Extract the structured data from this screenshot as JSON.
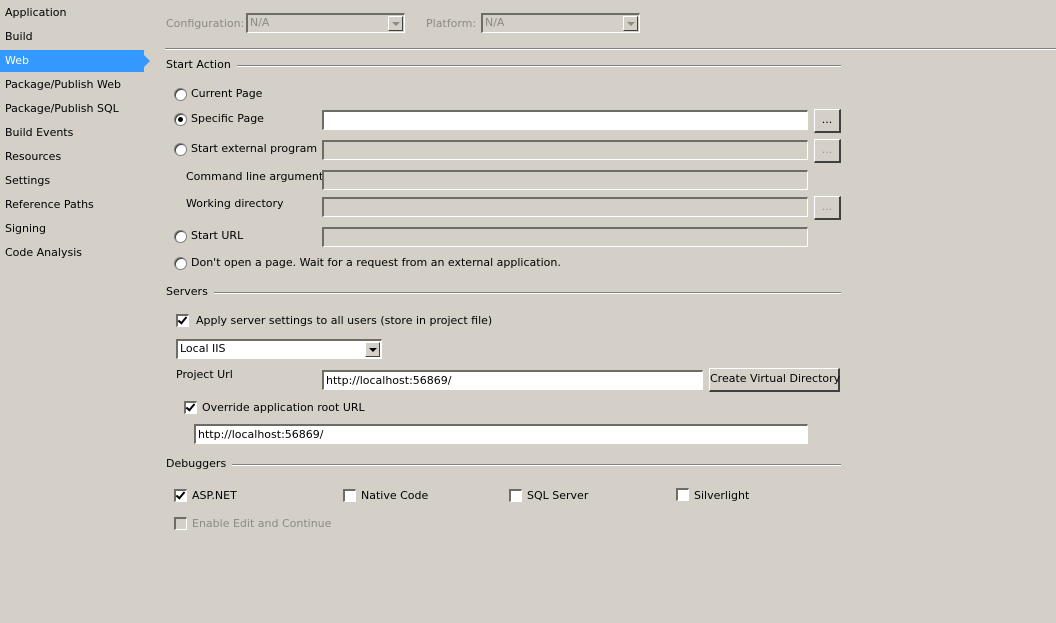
{
  "sidebar": {
    "items": [
      {
        "label": "Application"
      },
      {
        "label": "Build"
      },
      {
        "label": "Web",
        "active": true
      },
      {
        "label": "Package/Publish Web"
      },
      {
        "label": "Package/Publish SQL"
      },
      {
        "label": "Build Events"
      },
      {
        "label": "Resources"
      },
      {
        "label": "Settings"
      },
      {
        "label": "Reference Paths"
      },
      {
        "label": "Signing"
      },
      {
        "label": "Code Analysis"
      }
    ],
    "accent_color": "#3399ff"
  },
  "toolbar": {
    "configuration_label": "Configuration:",
    "configuration_value": "N/A",
    "platform_label": "Platform:",
    "platform_value": "N/A"
  },
  "start_action": {
    "heading": "Start Action",
    "current_page": "Current Page",
    "specific_page": "Specific Page",
    "specific_page_value": "",
    "start_external_program": "Start external program",
    "start_external_program_value": "",
    "command_line_arguments": "Command line arguments",
    "command_line_arguments_value": "",
    "working_directory": "Working directory",
    "working_directory_value": "",
    "start_url": "Start URL",
    "start_url_value": "",
    "dont_open": "Don't open a page.  Wait for a request from an external application.",
    "browse_label": "...",
    "selected": "specific_page"
  },
  "servers": {
    "heading": "Servers",
    "apply_all_users": "Apply server settings to all users (store in project file)",
    "apply_all_users_checked": true,
    "server_type": "Local IIS",
    "project_url_label": "Project Url",
    "project_url_value": "http://localhost:56869/",
    "create_virtual_directory": "Create Virtual Directory",
    "override_root_url": "Override application root URL",
    "override_root_url_checked": true,
    "override_root_url_value": "http://localhost:56869/"
  },
  "debuggers": {
    "heading": "Debuggers",
    "asp_net": "ASP.NET",
    "asp_net_checked": true,
    "native_code": "Native Code",
    "native_code_checked": false,
    "sql_server": "SQL Server",
    "sql_server_checked": false,
    "silverlight": "Silverlight",
    "silverlight_checked": false,
    "edit_and_continue": "Enable Edit and Continue",
    "edit_and_continue_checked": false
  }
}
